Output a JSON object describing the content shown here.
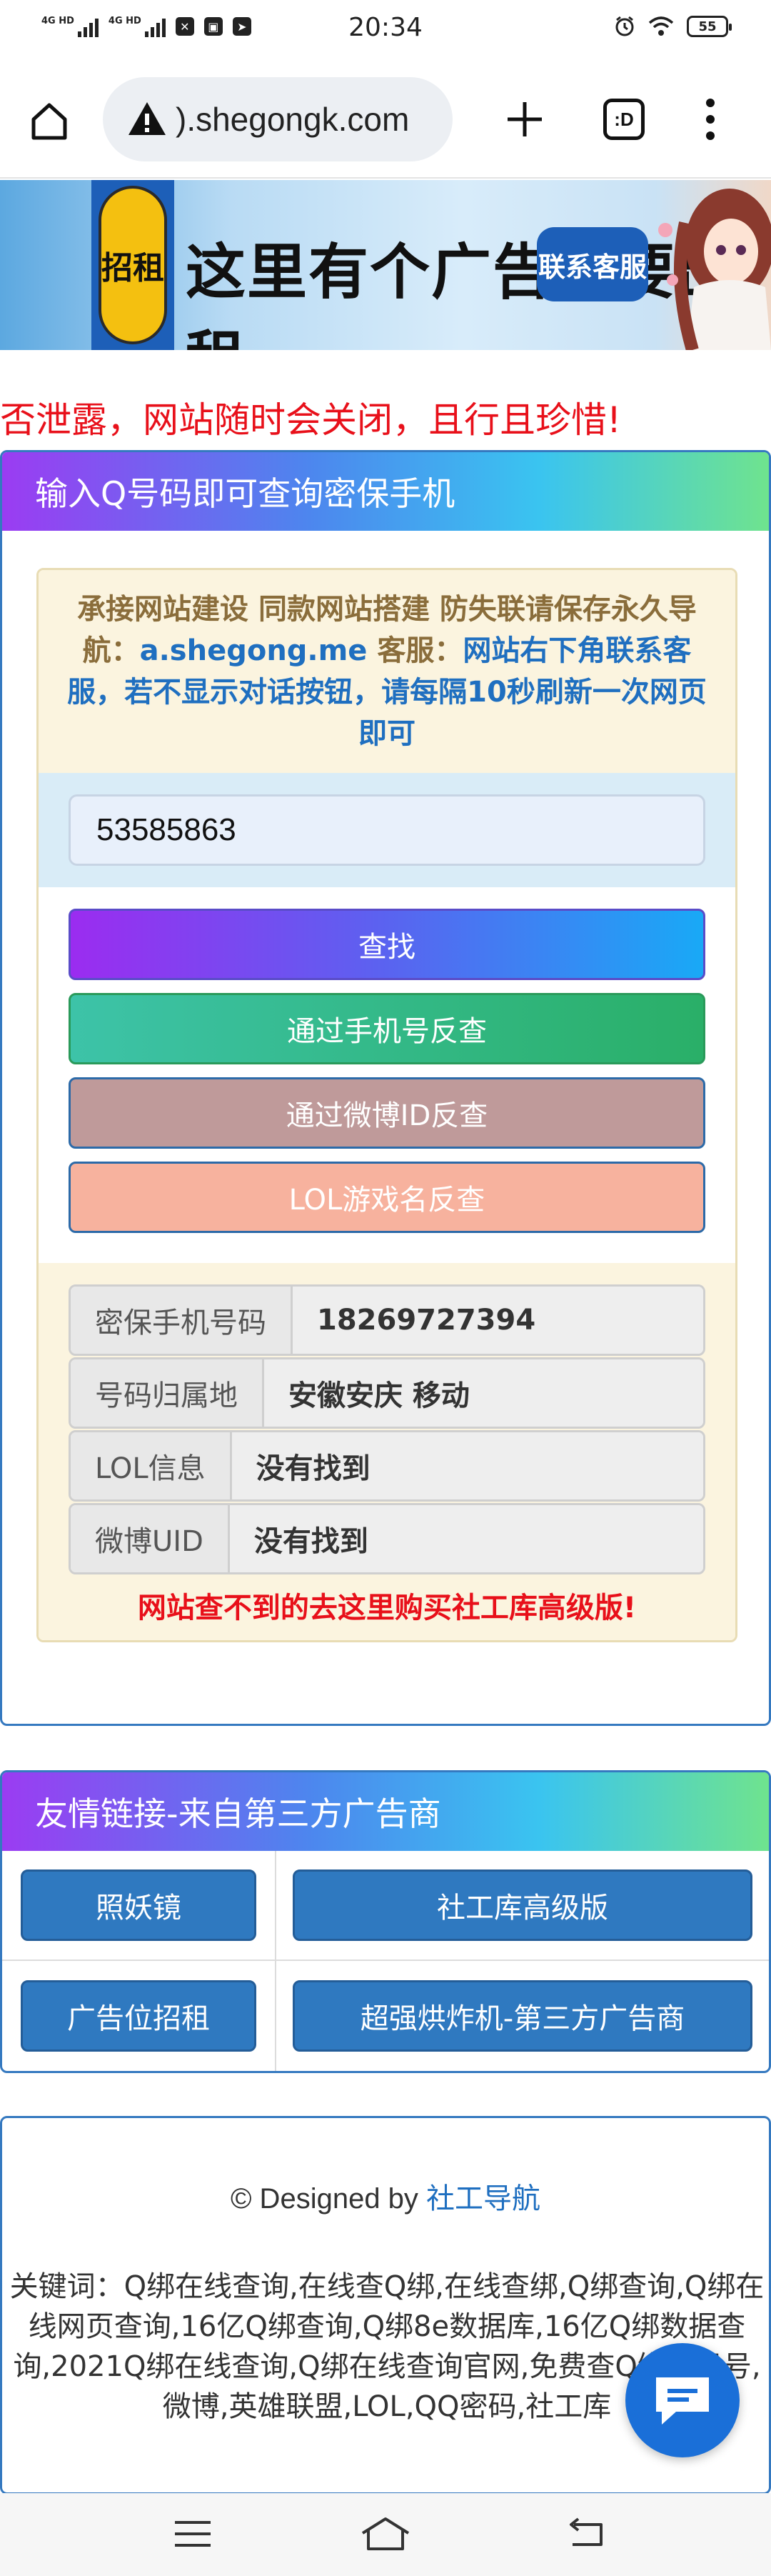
{
  "status_bar": {
    "time": "20:34",
    "signal1_label": "4G HD",
    "signal2_label": "4G HD",
    "battery": "55"
  },
  "browser": {
    "url": ").shegongk.com",
    "tabs_label": ":D"
  },
  "banner": {
    "badge": "招租",
    "text": "这里有个广告位要出租",
    "contact": "联系客服"
  },
  "warning_text": "否泄露，网站随时会关闭，且行且珍惜!",
  "query_panel": {
    "title": "输入Q号码即可查询密保手机",
    "notice_part1": "承接网站建设  同款网站搭建  防失联请保存永久导航：",
    "notice_link": "a.shegong.me",
    "notice_part2": "  客服：",
    "notice_part3": "网站右下角联系客服，若不显示对话按钮，请每隔10秒刷新一次网页即可",
    "qq_value": "53585863",
    "buttons": {
      "search": "查找",
      "phone_reverse": "通过手机号反查",
      "weibo_reverse": "通过微博ID反查",
      "lol_reverse": "LOL游戏名反查"
    },
    "results": [
      {
        "label": "密保手机号码",
        "value": "18269727394"
      },
      {
        "label": "号码归属地",
        "value": "安徽安庆 移动"
      },
      {
        "label": "LOL信息",
        "value": "没有找到"
      },
      {
        "label": "微博UID",
        "value": "没有找到"
      }
    ],
    "buy_note": "网站查不到的去这里购买社工库高级版!"
  },
  "links_panel": {
    "title": "友情链接-来自第三方广告商",
    "links": [
      {
        "left": "照妖镜",
        "right": "社工库高级版"
      },
      {
        "left": "广告位招租",
        "right": "超强烘炸机-第三方广告商"
      }
    ]
  },
  "footer": {
    "designed_prefix": "© Designed by ",
    "designed_link": "社工导航",
    "keywords": "关键词：Q绑在线查询,在线查Q绑,在线查绑,Q绑查询,Q绑在线网页查询,16亿Q绑查询,Q绑8e数据库,16亿Q绑数据查询,2021Q绑在线查询,Q绑在线查询官网,免费查Q绑手机号,微博,英雄联盟,LOL,QQ密码,社工库"
  },
  "colors": {
    "accent_blue": "#3579c0",
    "warning_red": "#e8101a",
    "notice_brown": "#8a6d3b"
  }
}
